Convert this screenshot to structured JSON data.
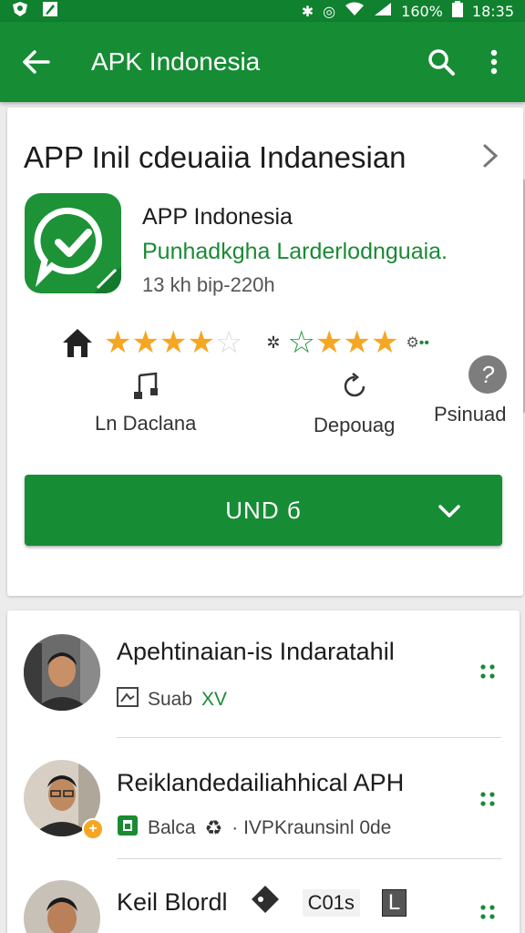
{
  "status_bar": {
    "battery": "160%",
    "time": "18:35"
  },
  "app_bar": {
    "title": "APK Indonesia"
  },
  "section": {
    "title": "APP Inil cdeuaiia Indanesian"
  },
  "app": {
    "name": "APP Indonesia",
    "developer": "Punhadkgha Larderlodnguaia.",
    "meta": "13 kh bip-220h"
  },
  "info_items": [
    {
      "label": "Ln Daclana"
    },
    {
      "label": "Depouag"
    },
    {
      "label": "Psinuad"
    }
  ],
  "install_button": {
    "label": "UND б"
  },
  "list": [
    {
      "name": "Apehtinaian-is Indaratahil",
      "sub_label": "Suab",
      "sub_extra": "XV"
    },
    {
      "name": "Reiklandedailiahhical APH",
      "sub_label": "Balca",
      "sub_extra": "· IVPKraunsinl 0de"
    },
    {
      "name": "Keil Blordl",
      "badge": "C01s",
      "badge2": "L"
    }
  ],
  "colors": {
    "brand_green": "#168c35",
    "star_gold": "#f5a623",
    "text_green": "#1a8a35"
  }
}
